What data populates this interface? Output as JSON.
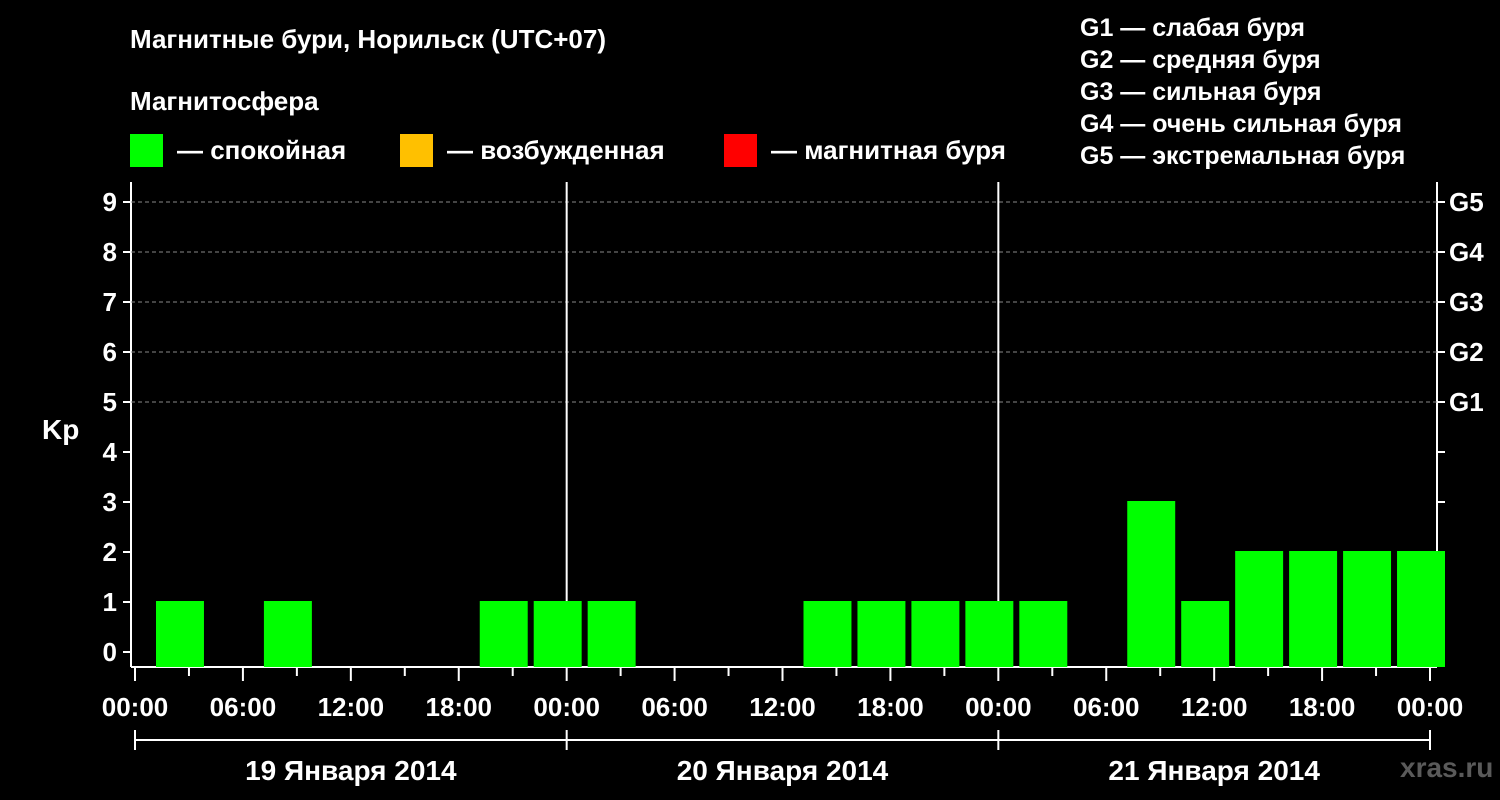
{
  "title": "Магнитные бури, Норильск (UTC+07)",
  "subtitle": "Магнитосфера",
  "legend": [
    {
      "label": "— спокойная",
      "color": "#00ff00"
    },
    {
      "label": "— возбужденная",
      "color": "#ffc000"
    },
    {
      "label": "— магнитная буря",
      "color": "#ff0000"
    }
  ],
  "g_legend": [
    "G1 — слабая буря",
    "G2 — средняя буря",
    "G3 — сильная буря",
    "G4 — очень сильная буря",
    "G5 — экстремальная буря"
  ],
  "watermark": "xras.ru",
  "chart_data": {
    "type": "bar",
    "ylabel": "Kp",
    "ylim": [
      0,
      9
    ],
    "y_ticks": [
      0,
      1,
      2,
      3,
      4,
      5,
      6,
      7,
      8,
      9
    ],
    "right_axis_labels": [
      {
        "value": 5,
        "label": "G1"
      },
      {
        "value": 6,
        "label": "G2"
      },
      {
        "value": 7,
        "label": "G3"
      },
      {
        "value": 8,
        "label": "G4"
      },
      {
        "value": 9,
        "label": "G5"
      }
    ],
    "x_tick_labels": [
      "00:00",
      "06:00",
      "12:00",
      "18:00",
      "00:00",
      "06:00",
      "12:00",
      "18:00",
      "00:00",
      "06:00",
      "12:00",
      "18:00",
      "00:00"
    ],
    "days": [
      "19 Января 2014",
      "20 Января 2014",
      "21 Января 2014"
    ],
    "interval_hours": 3,
    "values": [
      1,
      0,
      1,
      0,
      0,
      0,
      1,
      1,
      1,
      0,
      0,
      0,
      1,
      1,
      1,
      1,
      1,
      0,
      3,
      1,
      2,
      2,
      2,
      2
    ],
    "bar_color": "#00ff00",
    "grid": true
  }
}
